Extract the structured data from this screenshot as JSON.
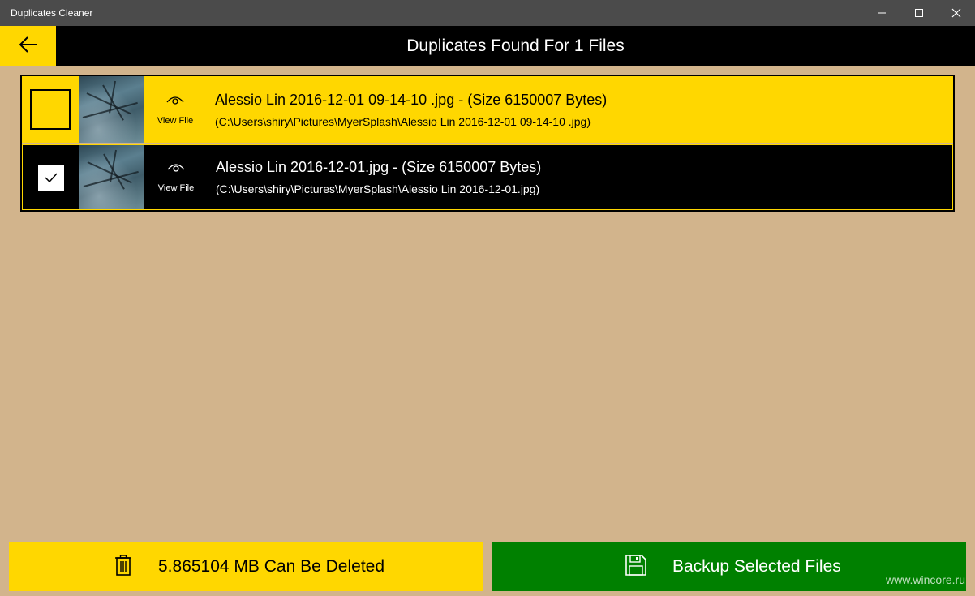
{
  "window": {
    "title": "Duplicates Cleaner",
    "minimize_icon": "minimize-icon",
    "maximize_icon": "maximize-icon",
    "close_icon": "close-icon"
  },
  "header": {
    "back_icon": "arrow-left-icon",
    "title": "Duplicates Found For 1 Files"
  },
  "files": [
    {
      "checked": false,
      "name": "Alessio Lin  2016-12-01 09-14-10 .jpg - (Size 6150007 Bytes)",
      "path": "(C:\\Users\\shiry\\Pictures\\MyerSplash\\Alessio Lin  2016-12-01 09-14-10 .jpg)",
      "view_label": "View File",
      "view_icon": "eye-icon"
    },
    {
      "checked": true,
      "name": "Alessio Lin  2016-12-01.jpg - (Size 6150007 Bytes)",
      "path": "(C:\\Users\\shiry\\Pictures\\MyerSplash\\Alessio Lin  2016-12-01.jpg)",
      "view_label": "View File",
      "view_icon": "eye-icon"
    }
  ],
  "footer": {
    "delete_icon": "trash-icon",
    "delete_label": "5.865104 MB Can Be Deleted",
    "backup_icon": "save-icon",
    "backup_label": "Backup Selected Files"
  },
  "watermark": "www.wincore.ru",
  "colors": {
    "background": "#d2b48c",
    "accent_yellow": "#ffd700",
    "header_black": "#000000",
    "backup_green": "#008000",
    "titlebar": "#4b4b4b"
  }
}
